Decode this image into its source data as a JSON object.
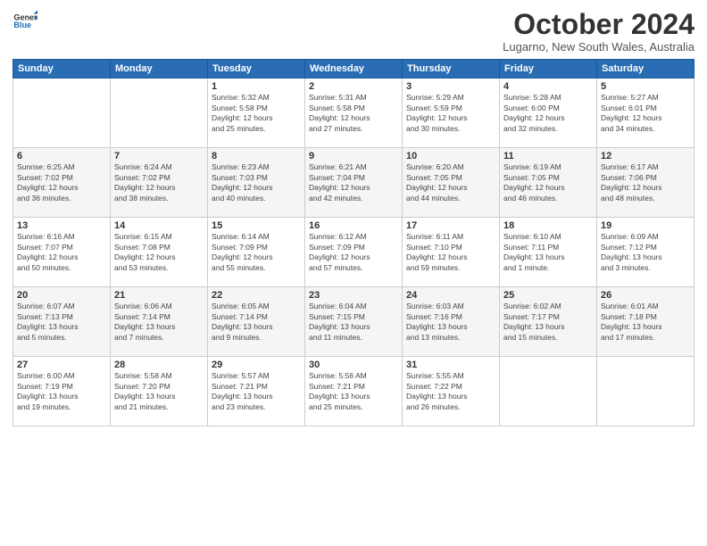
{
  "logo": {
    "line1": "General",
    "line2": "Blue"
  },
  "title": "October 2024",
  "subtitle": "Lugarno, New South Wales, Australia",
  "days_of_week": [
    "Sunday",
    "Monday",
    "Tuesday",
    "Wednesday",
    "Thursday",
    "Friday",
    "Saturday"
  ],
  "weeks": [
    [
      {
        "num": "",
        "info": ""
      },
      {
        "num": "",
        "info": ""
      },
      {
        "num": "1",
        "info": "Sunrise: 5:32 AM\nSunset: 5:58 PM\nDaylight: 12 hours\nand 25 minutes."
      },
      {
        "num": "2",
        "info": "Sunrise: 5:31 AM\nSunset: 5:58 PM\nDaylight: 12 hours\nand 27 minutes."
      },
      {
        "num": "3",
        "info": "Sunrise: 5:29 AM\nSunset: 5:59 PM\nDaylight: 12 hours\nand 30 minutes."
      },
      {
        "num": "4",
        "info": "Sunrise: 5:28 AM\nSunset: 6:00 PM\nDaylight: 12 hours\nand 32 minutes."
      },
      {
        "num": "5",
        "info": "Sunrise: 5:27 AM\nSunset: 6:01 PM\nDaylight: 12 hours\nand 34 minutes."
      }
    ],
    [
      {
        "num": "6",
        "info": "Sunrise: 6:25 AM\nSunset: 7:02 PM\nDaylight: 12 hours\nand 36 minutes."
      },
      {
        "num": "7",
        "info": "Sunrise: 6:24 AM\nSunset: 7:02 PM\nDaylight: 12 hours\nand 38 minutes."
      },
      {
        "num": "8",
        "info": "Sunrise: 6:23 AM\nSunset: 7:03 PM\nDaylight: 12 hours\nand 40 minutes."
      },
      {
        "num": "9",
        "info": "Sunrise: 6:21 AM\nSunset: 7:04 PM\nDaylight: 12 hours\nand 42 minutes."
      },
      {
        "num": "10",
        "info": "Sunrise: 6:20 AM\nSunset: 7:05 PM\nDaylight: 12 hours\nand 44 minutes."
      },
      {
        "num": "11",
        "info": "Sunrise: 6:19 AM\nSunset: 7:05 PM\nDaylight: 12 hours\nand 46 minutes."
      },
      {
        "num": "12",
        "info": "Sunrise: 6:17 AM\nSunset: 7:06 PM\nDaylight: 12 hours\nand 48 minutes."
      }
    ],
    [
      {
        "num": "13",
        "info": "Sunrise: 6:16 AM\nSunset: 7:07 PM\nDaylight: 12 hours\nand 50 minutes."
      },
      {
        "num": "14",
        "info": "Sunrise: 6:15 AM\nSunset: 7:08 PM\nDaylight: 12 hours\nand 53 minutes."
      },
      {
        "num": "15",
        "info": "Sunrise: 6:14 AM\nSunset: 7:09 PM\nDaylight: 12 hours\nand 55 minutes."
      },
      {
        "num": "16",
        "info": "Sunrise: 6:12 AM\nSunset: 7:09 PM\nDaylight: 12 hours\nand 57 minutes."
      },
      {
        "num": "17",
        "info": "Sunrise: 6:11 AM\nSunset: 7:10 PM\nDaylight: 12 hours\nand 59 minutes."
      },
      {
        "num": "18",
        "info": "Sunrise: 6:10 AM\nSunset: 7:11 PM\nDaylight: 13 hours\nand 1 minute."
      },
      {
        "num": "19",
        "info": "Sunrise: 6:09 AM\nSunset: 7:12 PM\nDaylight: 13 hours\nand 3 minutes."
      }
    ],
    [
      {
        "num": "20",
        "info": "Sunrise: 6:07 AM\nSunset: 7:13 PM\nDaylight: 13 hours\nand 5 minutes."
      },
      {
        "num": "21",
        "info": "Sunrise: 6:06 AM\nSunset: 7:14 PM\nDaylight: 13 hours\nand 7 minutes."
      },
      {
        "num": "22",
        "info": "Sunrise: 6:05 AM\nSunset: 7:14 PM\nDaylight: 13 hours\nand 9 minutes."
      },
      {
        "num": "23",
        "info": "Sunrise: 6:04 AM\nSunset: 7:15 PM\nDaylight: 13 hours\nand 11 minutes."
      },
      {
        "num": "24",
        "info": "Sunrise: 6:03 AM\nSunset: 7:16 PM\nDaylight: 13 hours\nand 13 minutes."
      },
      {
        "num": "25",
        "info": "Sunrise: 6:02 AM\nSunset: 7:17 PM\nDaylight: 13 hours\nand 15 minutes."
      },
      {
        "num": "26",
        "info": "Sunrise: 6:01 AM\nSunset: 7:18 PM\nDaylight: 13 hours\nand 17 minutes."
      }
    ],
    [
      {
        "num": "27",
        "info": "Sunrise: 6:00 AM\nSunset: 7:19 PM\nDaylight: 13 hours\nand 19 minutes."
      },
      {
        "num": "28",
        "info": "Sunrise: 5:58 AM\nSunset: 7:20 PM\nDaylight: 13 hours\nand 21 minutes."
      },
      {
        "num": "29",
        "info": "Sunrise: 5:57 AM\nSunset: 7:21 PM\nDaylight: 13 hours\nand 23 minutes."
      },
      {
        "num": "30",
        "info": "Sunrise: 5:56 AM\nSunset: 7:21 PM\nDaylight: 13 hours\nand 25 minutes."
      },
      {
        "num": "31",
        "info": "Sunrise: 5:55 AM\nSunset: 7:22 PM\nDaylight: 13 hours\nand 26 minutes."
      },
      {
        "num": "",
        "info": ""
      },
      {
        "num": "",
        "info": ""
      }
    ]
  ]
}
